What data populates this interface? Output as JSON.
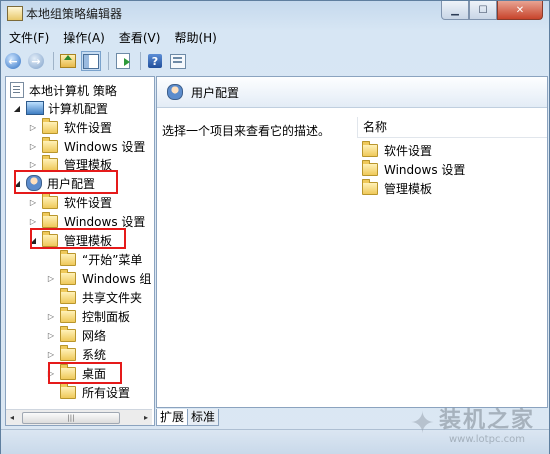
{
  "window": {
    "title": "本地组策略编辑器",
    "controls": {
      "minimize": "▁",
      "maximize": "☐",
      "close": "✕"
    }
  },
  "menubar": [
    "文件(F)",
    "操作(A)",
    "查看(V)",
    "帮助(H)"
  ],
  "toolbar": {
    "back": "←",
    "forward": "→",
    "help": "?"
  },
  "tree": {
    "root": "本地计算机 策略",
    "computer_config": "计算机配置",
    "computer_children": [
      "软件设置",
      "Windows 设置",
      "管理模板"
    ],
    "user_config": "用户配置",
    "user_children": [
      "软件设置",
      "Windows 设置"
    ],
    "admin_templates": "管理模板",
    "admin_children": [
      "“开始”菜单",
      "Windows 组",
      "共享文件夹",
      "控制面板",
      "网络",
      "系统"
    ],
    "desktop": "桌面",
    "all_settings": "所有设置"
  },
  "scrollbar": {
    "left": "◂",
    "right": "▸",
    "grip": "|||"
  },
  "right_pane": {
    "header": "用户配置",
    "description": "选择一个项目来查看它的描述。",
    "column_name": "名称",
    "items": [
      "软件设置",
      "Windows 设置",
      "管理模板"
    ]
  },
  "tabs": [
    "扩展",
    "标准"
  ],
  "watermark": {
    "text": "装机之家",
    "url": "www.lotpc.com"
  },
  "colors": {
    "highlight": "#e51a1a",
    "pane_border": "#8ba3bf",
    "folder": "#efc95a"
  }
}
